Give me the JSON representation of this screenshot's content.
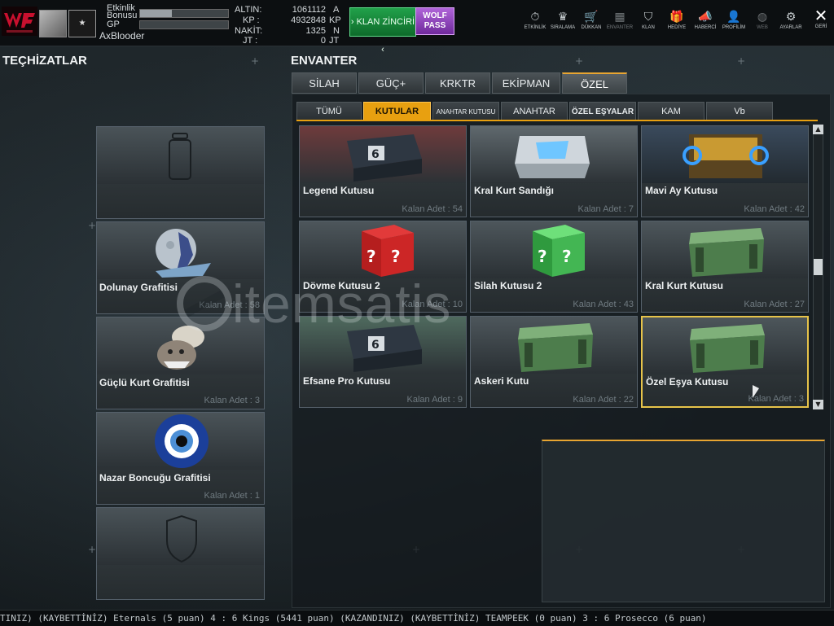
{
  "header": {
    "rank_label": "★",
    "etkinlik_label": "Etkinlik",
    "bonus_label": "Bonusu",
    "gp_label": "GP",
    "username": "AxBlooder",
    "currencies": [
      {
        "label": "ALTIN:",
        "value": "1061112",
        "unit": "A"
      },
      {
        "label": "KP  :",
        "value": "4932848",
        "unit": "KP"
      },
      {
        "label": "NAKİT:",
        "value": "1325",
        "unit": "N"
      },
      {
        "label": "JT  :",
        "value": "0",
        "unit": "JT"
      }
    ],
    "klan_button": "› KLAN ZİNCİRİ ‹",
    "wolf_button_line1": "WOLF",
    "wolf_button_line2": "PASS",
    "nav": [
      {
        "label": "ETKİNLİK",
        "icon": "⏱"
      },
      {
        "label": "SIRALAMA",
        "icon": "♛"
      },
      {
        "label": "DÜKKAN",
        "icon": "🛒"
      },
      {
        "label": "ENVANTER",
        "icon": "▦"
      },
      {
        "label": "KLAN",
        "icon": "⛉"
      },
      {
        "label": "HEDİYE",
        "icon": "🎁"
      },
      {
        "label": "HABERCİ",
        "icon": "📣"
      },
      {
        "label": "PROFİLİM",
        "icon": "👤"
      },
      {
        "label": "WEB",
        "icon": "◍"
      },
      {
        "label": "AYARLAR",
        "icon": "⚙"
      }
    ],
    "close_icon": "✕",
    "close_label": "GERİ"
  },
  "equipment": {
    "title": "TEÇHİZATLAR",
    "items": [
      {
        "name": "",
        "count": ""
      },
      {
        "name": "Dolunay Grafitisi",
        "count": "Kalan Adet : 58"
      },
      {
        "name": "Güçlü Kurt Grafitisi",
        "count": "Kalan Adet : 3"
      },
      {
        "name": "Nazar Boncuğu Grafitisi",
        "count": "Kalan Adet : 1"
      },
      {
        "name": "",
        "count": ""
      }
    ]
  },
  "inventory": {
    "title": "ENVANTER",
    "tabs": [
      "SİLAH",
      "GÜÇ+",
      "KRKTR",
      "EKİPMAN",
      "ÖZEL"
    ],
    "active_tab": "ÖZEL",
    "subtabs": [
      "TÜMÜ",
      "KUTULAR",
      "ANAHTAR KUTUSU",
      "ANAHTAR",
      "ÖZEL EŞYALAR",
      "KAM",
      "Vb"
    ],
    "active_subtab": "KUTULAR",
    "items": [
      {
        "name": "Legend Kutusu",
        "count": "Kalan Adet : 54"
      },
      {
        "name": "Kral Kurt Sandığı",
        "count": "Kalan Adet : 7"
      },
      {
        "name": "Mavi Ay Kutusu",
        "count": "Kalan Adet : 42"
      },
      {
        "name": "Dövme Kutusu 2",
        "count": "Kalan Adet : 10"
      },
      {
        "name": "Silah Kutusu 2",
        "count": "Kalan Adet : 43"
      },
      {
        "name": "Kral Kurt Kutusu",
        "count": "Kalan Adet : 27"
      },
      {
        "name": "Efsane Pro Kutusu",
        "count": "Kalan Adet : 9"
      },
      {
        "name": "Askeri Kutu",
        "count": "Kalan Adet : 22"
      },
      {
        "name": "Özel Eşya Kutusu",
        "count": "Kalan Adet : 3"
      }
    ],
    "selected_item": "Özel Eşya Kutusu"
  },
  "watermark": "itemsatis",
  "ticker": "TINIZ)     (KAYBETTİNİZ) Eternals (5 puan) 4 : 6 Kings (5441 puan) (KAZANDINIZ)        (KAYBETTİNİZ) TEAMPEEK (0 puan) 3 : 6 Prosecco (6 puan)"
}
